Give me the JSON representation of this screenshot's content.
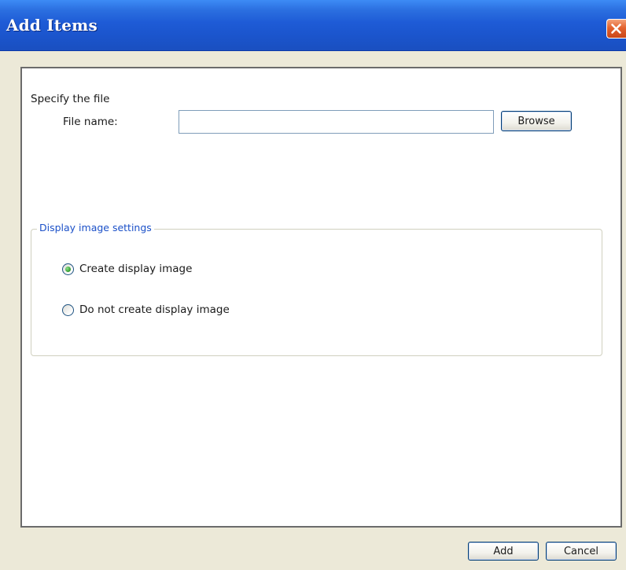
{
  "window": {
    "title": "Add Items",
    "close_icon": "close-icon"
  },
  "file_section": {
    "heading": "Specify the file",
    "file_name_label": "File name:",
    "file_name_value": "",
    "browse_label": "Browse"
  },
  "display_settings": {
    "legend": "Display image settings",
    "options": [
      {
        "label": "Create display image",
        "selected": true
      },
      {
        "label": "Do not create display image",
        "selected": false
      }
    ]
  },
  "footer": {
    "add_label": "Add",
    "cancel_label": "Cancel"
  },
  "colors": {
    "titlebar": "#1e5bd6",
    "close_button": "#e3622e",
    "dialog_background": "#ece9d8",
    "legend_text": "#1b50c8",
    "radio_selected": "#2f9a2d"
  }
}
